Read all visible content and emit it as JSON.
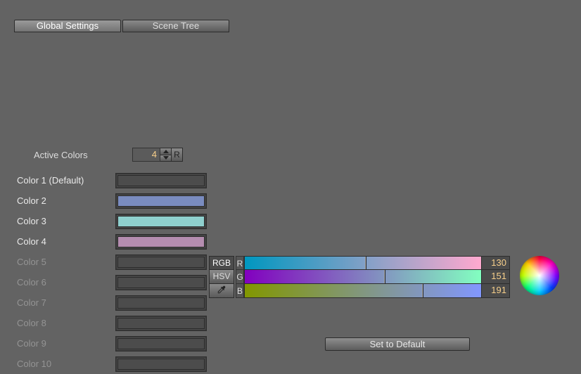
{
  "tabs": {
    "global": "Global Settings",
    "scene": "Scene Tree",
    "active_index": 0
  },
  "active_colors": {
    "label": "Active Colors",
    "value": "4",
    "reset": "R"
  },
  "colors": [
    {
      "label": "Color 1 (Default)",
      "active": true,
      "swatch": "#4c4c4c"
    },
    {
      "label": "Color 2",
      "active": true,
      "swatch": "#7a8cc0"
    },
    {
      "label": "Color 3",
      "active": true,
      "swatch": "#8fd0ce"
    },
    {
      "label": "Color 4",
      "active": true,
      "swatch": "#b58db0"
    },
    {
      "label": "Color 5",
      "active": false,
      "swatch": "#4c4c4c"
    },
    {
      "label": "Color 6",
      "active": false,
      "swatch": "#4c4c4c"
    },
    {
      "label": "Color 7",
      "active": false,
      "swatch": "#4c4c4c"
    },
    {
      "label": "Color 8",
      "active": false,
      "swatch": "#4c4c4c"
    },
    {
      "label": "Color 9",
      "active": false,
      "swatch": "#4c4c4c"
    },
    {
      "label": "Color 10",
      "active": false,
      "swatch": "#4c4c4c"
    }
  ],
  "mixer": {
    "modes": {
      "rgb": "RGB",
      "hsv": "HSV",
      "selected": "rgb"
    },
    "channels": [
      {
        "key": "R",
        "value": "130",
        "grad_from": "#0097bf",
        "grad_to": "#ffa9cf",
        "handle": 0.51
      },
      {
        "key": "G",
        "value": "151",
        "grad_from": "#8200bf",
        "grad_to": "#82ffc0",
        "handle": 0.59
      },
      {
        "key": "B",
        "value": "191",
        "grad_from": "#829700",
        "grad_to": "#8297ff",
        "handle": 0.75
      }
    ]
  },
  "buttons": {
    "set_default": "Set to Default"
  }
}
